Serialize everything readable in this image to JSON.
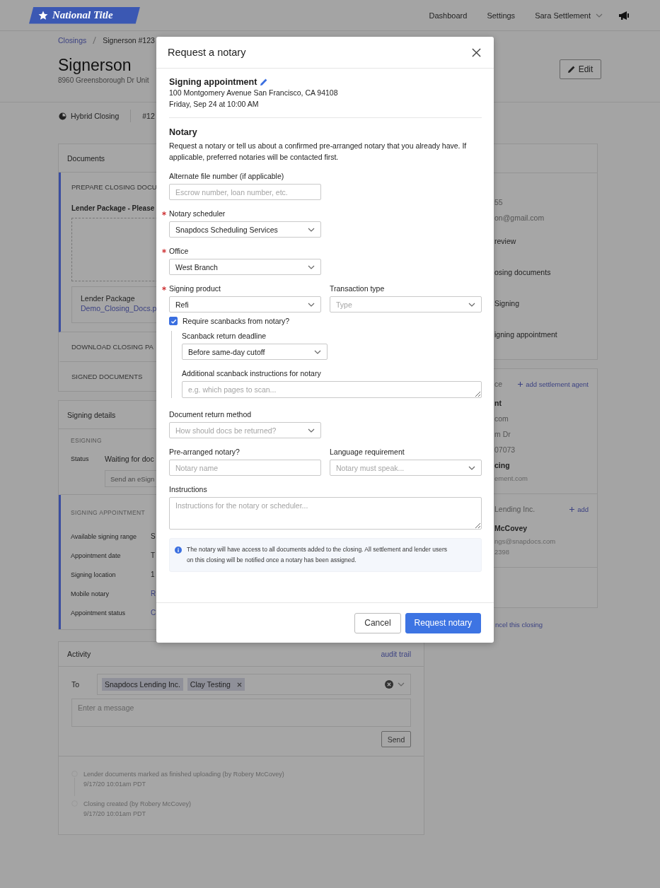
{
  "topbar": {
    "logo": "National Title",
    "nav": [
      {
        "label": "Dashboard"
      },
      {
        "label": "Settings"
      }
    ],
    "user": "Sara Settlement"
  },
  "breadcrumb": [
    {
      "label": "Closings",
      "link": true
    },
    {
      "label": "Signerson #123",
      "link": false
    }
  ],
  "closing": {
    "title": "Signerson",
    "address": "8960 Greensborough Dr Unit",
    "edit": "Edit",
    "type": "Hybrid Closing",
    "number": "#12"
  },
  "documents": {
    "title": "Documents",
    "sections": [
      {
        "title": "PREPARE CLOSING DOCU",
        "active": true,
        "package_label": "Lender Package - Please",
        "file": {
          "name": "Lender Package",
          "link": "Demo_Closing_Docs.p"
        }
      },
      {
        "title": "DOWNLOAD CLOSING PA",
        "active": false
      },
      {
        "title": "SIGNED DOCUMENTS",
        "active": false
      }
    ]
  },
  "signing": {
    "title": "Signing details",
    "sections": [
      {
        "title": "ESIGNING",
        "active": false,
        "status_label": "Status",
        "status": "Waiting for doc",
        "input_placeholder": "Send an eSign"
      },
      {
        "title": "SIGNING APPOINTMENT",
        "active": true,
        "rows": [
          {
            "label": "Available signing range",
            "value": "S",
            "link": false
          },
          {
            "label": "Appointment date",
            "value": "T",
            "link": false
          },
          {
            "label": "Signing location",
            "value": "1",
            "link": false
          },
          {
            "label": "Mobile notary",
            "value": "R",
            "link": true
          },
          {
            "label": "Appointment status",
            "value": "C",
            "link": true
          }
        ]
      }
    ]
  },
  "activity": {
    "title": "Activity",
    "audit_link": "audit trail",
    "to_label": "To",
    "recipients": [
      {
        "name": "Snapdocs Lending Inc.",
        "removable": false
      },
      {
        "name": "Clay Testing",
        "removable": true
      }
    ],
    "message_placeholder": "Enter a message",
    "send": "Send",
    "events": [
      {
        "text": "Lender documents marked as finished uploading (by Robery McCovey)",
        "time": "9/17/20 10:01am PDT"
      },
      {
        "text": "Closing created (by Robery McCovey)",
        "time": "9/17/20 10:01am PDT"
      }
    ]
  },
  "side": {
    "cards": [
      {
        "blocks": [
          {
            "lines": [
              {
                "text": "55",
                "kind": "muted"
              },
              {
                "text": "on@gmail.com",
                "kind": "muted"
              },
              {
                "text": "review",
                "kind": "item"
              },
              {
                "text": "osing documents",
                "kind": "item"
              },
              {
                "text": "Signing",
                "kind": "item"
              },
              {
                "text": "igning appointment",
                "kind": "item"
              }
            ]
          }
        ]
      },
      {
        "blocks": [
          {
            "header": "ce",
            "action": "add settlement agent",
            "lines": [
              {
                "text": "nt",
                "kind": "bold"
              },
              {
                "text": "com",
                "kind": "muted"
              },
              {
                "text": "m Dr",
                "kind": "muted"
              },
              {
                "text": "07073",
                "kind": "muted"
              },
              {
                "text": "cing",
                "kind": "bold"
              },
              {
                "text": "ement.com",
                "kind": "small"
              }
            ]
          },
          {
            "header": "Lending Inc.",
            "action": "add",
            "lines": [
              {
                "text": "McCovey",
                "kind": "bold"
              },
              {
                "text": "ngs@snapdocs.com",
                "kind": "small"
              },
              {
                "text": "2398",
                "kind": "small"
              }
            ]
          }
        ]
      }
    ],
    "cancel_link": "ncel this closing"
  },
  "modal": {
    "title": "Request a notary",
    "appointment": {
      "title": "Signing appointment",
      "address": "100 Montgomery Avenue San Francisco, CA 94108",
      "when": "Friday, Sep 24 at 10:00 AM"
    },
    "section_title": "Notary",
    "description": "Request a notary or tell us about a confirmed pre-arranged notary that you already have. If applicable, preferred notaries will be contacted first.",
    "form": [
      {
        "kind": "fields",
        "fields": [
          {
            "kind": "input",
            "label": "Alternate file number (if applicable)",
            "required": false,
            "placeholder": "Escrow number, loan number, etc."
          }
        ]
      },
      {
        "kind": "fields",
        "fields": [
          {
            "kind": "select",
            "label": "Notary scheduler",
            "required": true,
            "value": "Snapdocs Scheduling Services"
          }
        ]
      },
      {
        "kind": "fields",
        "fields": [
          {
            "kind": "select",
            "label": "Office",
            "required": true,
            "value": "West Branch"
          }
        ]
      },
      {
        "kind": "fields",
        "fields": [
          {
            "kind": "select",
            "label": "Signing product",
            "required": true,
            "value": "Refi"
          },
          {
            "kind": "select",
            "label": "Transaction type",
            "required": false,
            "placeholder": "Type"
          }
        ]
      },
      {
        "kind": "checkbox",
        "label": "Require scanbacks from notary?",
        "checked": true
      },
      {
        "kind": "group",
        "rows": [
          {
            "kind": "fields",
            "fields": [
              {
                "kind": "select",
                "label": "Scanback return deadline",
                "required": false,
                "value": "Before same-day cutoff"
              }
            ]
          },
          {
            "kind": "fields",
            "fields": [
              {
                "kind": "textarea",
                "label": "Additional scanback instructions for notary",
                "required": false,
                "tall": false,
                "placeholder": "e.g. which pages to scan..."
              }
            ]
          }
        ]
      },
      {
        "kind": "fields",
        "fields": [
          {
            "kind": "select",
            "label": "Document return method",
            "required": false,
            "placeholder": "How should docs be returned?"
          }
        ]
      },
      {
        "kind": "fields",
        "fields": [
          {
            "kind": "input",
            "label": "Pre-arranged notary?",
            "required": false,
            "placeholder": "Notary name"
          },
          {
            "kind": "select",
            "label": "Language requirement",
            "required": false,
            "placeholder": "Notary must speak..."
          }
        ]
      },
      {
        "kind": "fields",
        "fields": [
          {
            "kind": "textarea",
            "label": "Instructions",
            "required": false,
            "tall": true,
            "placeholder": "Instructions for the notary or scheduler..."
          }
        ]
      }
    ],
    "note": "The notary will have access to all documents added to the closing. All settlement and lender users on this closing will be notified once a notary has been assigned.",
    "buttons": [
      {
        "label": "Cancel",
        "primary": false
      },
      {
        "label": "Request notary",
        "primary": true
      }
    ]
  }
}
